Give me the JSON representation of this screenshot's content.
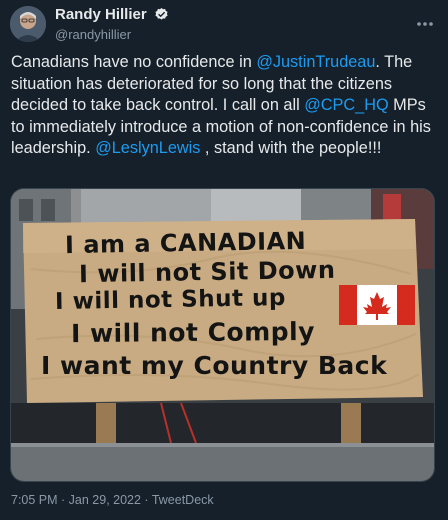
{
  "author": {
    "display_name": "Randy Hillier",
    "handle": "@randyhillier"
  },
  "tweet": {
    "segments": [
      {
        "text": "Canadians have no confidence in ",
        "type": "text"
      },
      {
        "text": "@JustinTrudeau",
        "type": "mention"
      },
      {
        "text": ". The situation has deteriorated for so long that the citizens decided to take back control. I call on all ",
        "type": "text"
      },
      {
        "text": "@CPC_HQ",
        "type": "mention"
      },
      {
        "text": " MPs to immediately introduce a motion of non-confidence in his leadership. ",
        "type": "text"
      },
      {
        "text": "@LeslynLewis",
        "type": "mention"
      },
      {
        "text": " , stand with the people!!!",
        "type": "text"
      }
    ],
    "timestamp": "7:05 PM · Jan 29, 2022 · TweetDeck"
  },
  "photo": {
    "sign_lines": [
      "I am a CANADIAN",
      "I will not Sit Down",
      "I will not Shut up",
      "I will not Comply",
      "I want my Country Back"
    ]
  },
  "colors": {
    "background": "#15202b",
    "accent": "#1d9bf0",
    "secondary_text": "#8b98a5",
    "primary_text": "#e7e9ea"
  },
  "icons": {
    "verified": "verified-badge-icon",
    "more": "more-options-icon"
  }
}
